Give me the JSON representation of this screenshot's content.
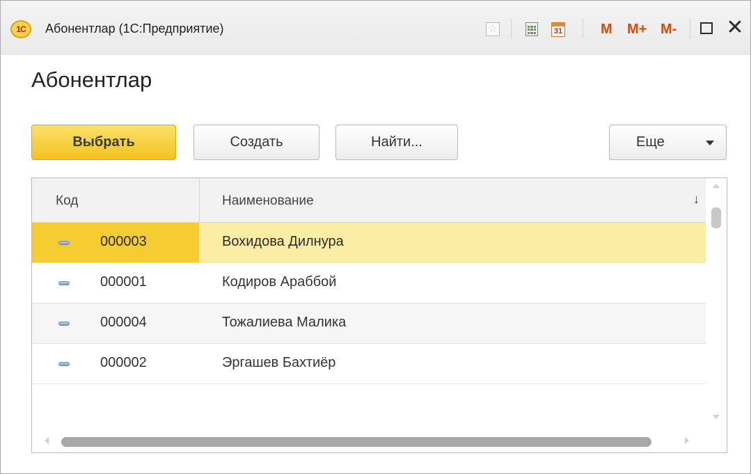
{
  "window": {
    "title": "Абонентлар  (1С:Предприятие)",
    "logo_text": "1С",
    "calendar_day": "31",
    "mem_m": "M",
    "mem_mplus": "M+",
    "mem_mminus": "M-",
    "close_glyph": "✕"
  },
  "page": {
    "title": "Абонентлар"
  },
  "toolbar": {
    "select_label": "Выбрать",
    "create_label": "Создать",
    "find_label": "Найти...",
    "more_label": "Еще"
  },
  "table": {
    "columns": {
      "code": "Код",
      "name": "Наименование",
      "sort_glyph": "↓"
    },
    "rows": [
      {
        "code": "000003",
        "name": "Вохидова Дилнура",
        "selected": true
      },
      {
        "code": "000001",
        "name": "Кодиров Араббой",
        "selected": false
      },
      {
        "code": "000004",
        "name": "Тожалиева Малика",
        "selected": false
      },
      {
        "code": "000002",
        "name": "Эргашев Бахтиёр",
        "selected": false
      }
    ]
  },
  "colors": {
    "accent_yellow": "#f3c21f",
    "selected_row": "#fbeda3",
    "memory_buttons": "#d44d10"
  },
  "icons": {
    "favorite": "star-icon",
    "calculator": "calculator-icon",
    "calendar": "calendar-icon",
    "restore": "restore-icon",
    "close": "close-icon",
    "row_item": "catalog-item-icon",
    "more_dropdown": "chevron-down-icon"
  }
}
